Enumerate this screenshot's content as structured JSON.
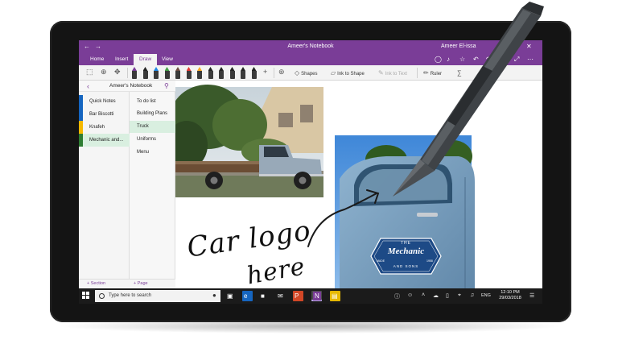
{
  "app": {
    "title": "Ameer's Notebook",
    "user": "Ameer El-issa",
    "accent": "#7a3d97"
  },
  "tabs": [
    {
      "label": "Home"
    },
    {
      "label": "Insert"
    },
    {
      "label": "Draw",
      "active": true
    },
    {
      "label": "View"
    }
  ],
  "toolbar": {
    "pen_colors": [
      "#7a3d97",
      "#222222",
      "#1e88e5",
      "#43a047",
      "#6d4c41",
      "#e53935",
      "#f9a825",
      "#222222",
      "#222222",
      "#222222",
      "#222222",
      "#222222"
    ],
    "shapes_label": "Shapes",
    "ink_to_shape_label": "Ink to Shape",
    "ink_to_text_label": "Ink to Text",
    "ruler_label": "Ruler"
  },
  "nav": {
    "notebook_name": "Ameer's Notebook",
    "sections": [
      {
        "label": "Quick Notes",
        "color": "#1565c0"
      },
      {
        "label": "Bar Biscotti",
        "color": "#1565c0"
      },
      {
        "label": "Knafeh",
        "color": "#f5b800"
      },
      {
        "label": "Mechanic and...",
        "color": "#2e7d32",
        "active": true
      }
    ],
    "pages": [
      {
        "label": "To do list"
      },
      {
        "label": "Building Plans"
      },
      {
        "label": "Truck",
        "active": true
      },
      {
        "label": "Uniforms"
      },
      {
        "label": "Menu"
      }
    ],
    "add_section_label": "Section",
    "add_page_label": "Page"
  },
  "canvas": {
    "handwriting_line1": "Car logo",
    "handwriting_line2": "here",
    "logo": {
      "top": "THE",
      "name": "Mechanic",
      "left_small": "MADE",
      "right_small": "1958",
      "bottom": "AND SONS"
    }
  },
  "taskbar": {
    "search_placeholder": "Type here to search",
    "language": "ENG",
    "time": "12:10 PM",
    "date": "29/03/2018"
  }
}
